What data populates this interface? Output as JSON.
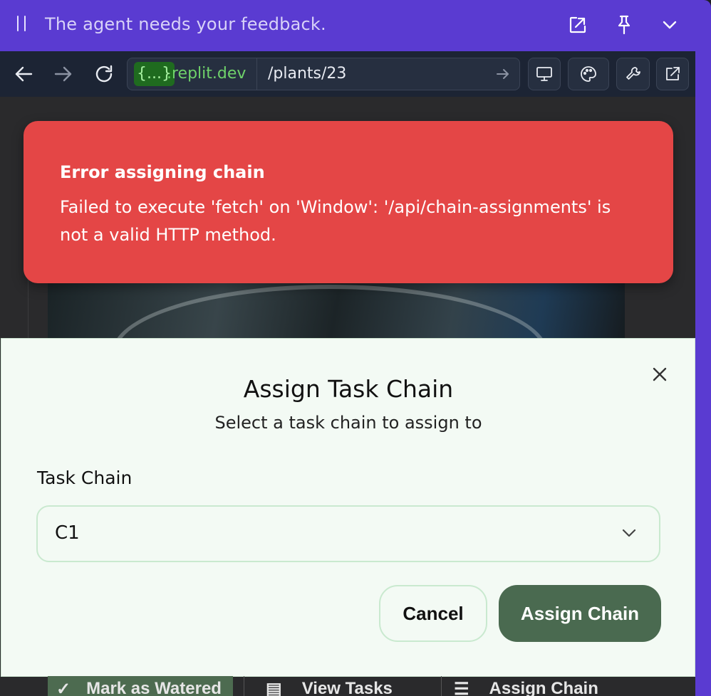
{
  "banner": {
    "message": "The agent needs your feedback.",
    "icons": [
      "drag-handle-icon",
      "open-external-icon",
      "pin-icon",
      "chevron-down-icon"
    ]
  },
  "browser": {
    "url_badge": "{...}",
    "url_domain": ".replit.dev",
    "url_path": "/plants/23",
    "nav_icons": [
      "back-arrow-icon",
      "forward-arrow-icon",
      "reload-icon"
    ],
    "tool_icons": [
      "monitor-icon",
      "palette-icon",
      "wrench-icon",
      "open-new-tab-icon"
    ]
  },
  "toast": {
    "title": "Error assigning chain",
    "body": "Failed to execute 'fetch' on 'Window': '/api/chain-assignments' is not a valid HTTP method.",
    "color": "#e44646"
  },
  "dialog": {
    "title": "Assign Task Chain",
    "subtitle": "Select a task chain to assign to",
    "field_label": "Task Chain",
    "selected_value": "C1",
    "cancel_label": "Cancel",
    "submit_label": "Assign Chain",
    "accent": "#4a6a50"
  },
  "background_actions": {
    "mark_watered": "Mark as Watered",
    "view_tasks": "View Tasks",
    "assign_chain": "Assign Chain"
  }
}
